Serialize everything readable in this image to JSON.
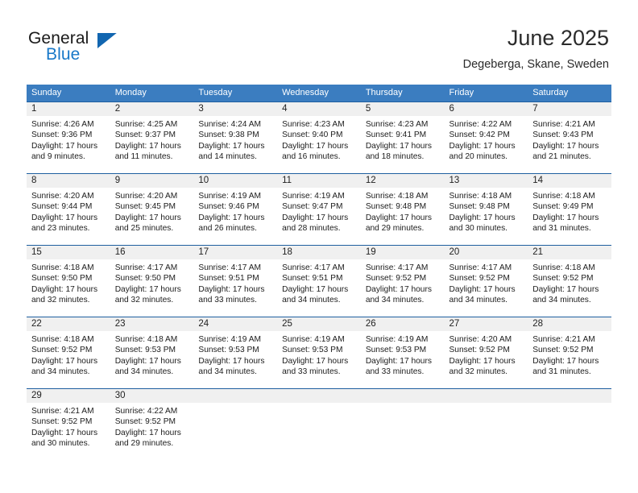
{
  "brand": {
    "name_part1": "General",
    "name_part2": "Blue",
    "accent_color": "#1878c8",
    "logo_icon": "triangle-flag-icon"
  },
  "header": {
    "title": "June 2025",
    "location": "Degeberga, Skane, Sweden"
  },
  "calendar": {
    "header_bg": "#3b7dc0",
    "row_border_color": "#1f5fa0",
    "daynum_band_bg": "#f0f0f0",
    "weekdays": [
      "Sunday",
      "Monday",
      "Tuesday",
      "Wednesday",
      "Thursday",
      "Friday",
      "Saturday"
    ],
    "weeks": [
      [
        {
          "day": "1",
          "sunrise": "Sunrise: 4:26 AM",
          "sunset": "Sunset: 9:36 PM",
          "daylight_line1": "Daylight: 17 hours",
          "daylight_line2": "and 9 minutes."
        },
        {
          "day": "2",
          "sunrise": "Sunrise: 4:25 AM",
          "sunset": "Sunset: 9:37 PM",
          "daylight_line1": "Daylight: 17 hours",
          "daylight_line2": "and 11 minutes."
        },
        {
          "day": "3",
          "sunrise": "Sunrise: 4:24 AM",
          "sunset": "Sunset: 9:38 PM",
          "daylight_line1": "Daylight: 17 hours",
          "daylight_line2": "and 14 minutes."
        },
        {
          "day": "4",
          "sunrise": "Sunrise: 4:23 AM",
          "sunset": "Sunset: 9:40 PM",
          "daylight_line1": "Daylight: 17 hours",
          "daylight_line2": "and 16 minutes."
        },
        {
          "day": "5",
          "sunrise": "Sunrise: 4:23 AM",
          "sunset": "Sunset: 9:41 PM",
          "daylight_line1": "Daylight: 17 hours",
          "daylight_line2": "and 18 minutes."
        },
        {
          "day": "6",
          "sunrise": "Sunrise: 4:22 AM",
          "sunset": "Sunset: 9:42 PM",
          "daylight_line1": "Daylight: 17 hours",
          "daylight_line2": "and 20 minutes."
        },
        {
          "day": "7",
          "sunrise": "Sunrise: 4:21 AM",
          "sunset": "Sunset: 9:43 PM",
          "daylight_line1": "Daylight: 17 hours",
          "daylight_line2": "and 21 minutes."
        }
      ],
      [
        {
          "day": "8",
          "sunrise": "Sunrise: 4:20 AM",
          "sunset": "Sunset: 9:44 PM",
          "daylight_line1": "Daylight: 17 hours",
          "daylight_line2": "and 23 minutes."
        },
        {
          "day": "9",
          "sunrise": "Sunrise: 4:20 AM",
          "sunset": "Sunset: 9:45 PM",
          "daylight_line1": "Daylight: 17 hours",
          "daylight_line2": "and 25 minutes."
        },
        {
          "day": "10",
          "sunrise": "Sunrise: 4:19 AM",
          "sunset": "Sunset: 9:46 PM",
          "daylight_line1": "Daylight: 17 hours",
          "daylight_line2": "and 26 minutes."
        },
        {
          "day": "11",
          "sunrise": "Sunrise: 4:19 AM",
          "sunset": "Sunset: 9:47 PM",
          "daylight_line1": "Daylight: 17 hours",
          "daylight_line2": "and 28 minutes."
        },
        {
          "day": "12",
          "sunrise": "Sunrise: 4:18 AM",
          "sunset": "Sunset: 9:48 PM",
          "daylight_line1": "Daylight: 17 hours",
          "daylight_line2": "and 29 minutes."
        },
        {
          "day": "13",
          "sunrise": "Sunrise: 4:18 AM",
          "sunset": "Sunset: 9:48 PM",
          "daylight_line1": "Daylight: 17 hours",
          "daylight_line2": "and 30 minutes."
        },
        {
          "day": "14",
          "sunrise": "Sunrise: 4:18 AM",
          "sunset": "Sunset: 9:49 PM",
          "daylight_line1": "Daylight: 17 hours",
          "daylight_line2": "and 31 minutes."
        }
      ],
      [
        {
          "day": "15",
          "sunrise": "Sunrise: 4:18 AM",
          "sunset": "Sunset: 9:50 PM",
          "daylight_line1": "Daylight: 17 hours",
          "daylight_line2": "and 32 minutes."
        },
        {
          "day": "16",
          "sunrise": "Sunrise: 4:17 AM",
          "sunset": "Sunset: 9:50 PM",
          "daylight_line1": "Daylight: 17 hours",
          "daylight_line2": "and 32 minutes."
        },
        {
          "day": "17",
          "sunrise": "Sunrise: 4:17 AM",
          "sunset": "Sunset: 9:51 PM",
          "daylight_line1": "Daylight: 17 hours",
          "daylight_line2": "and 33 minutes."
        },
        {
          "day": "18",
          "sunrise": "Sunrise: 4:17 AM",
          "sunset": "Sunset: 9:51 PM",
          "daylight_line1": "Daylight: 17 hours",
          "daylight_line2": "and 34 minutes."
        },
        {
          "day": "19",
          "sunrise": "Sunrise: 4:17 AM",
          "sunset": "Sunset: 9:52 PM",
          "daylight_line1": "Daylight: 17 hours",
          "daylight_line2": "and 34 minutes."
        },
        {
          "day": "20",
          "sunrise": "Sunrise: 4:17 AM",
          "sunset": "Sunset: 9:52 PM",
          "daylight_line1": "Daylight: 17 hours",
          "daylight_line2": "and 34 minutes."
        },
        {
          "day": "21",
          "sunrise": "Sunrise: 4:18 AM",
          "sunset": "Sunset: 9:52 PM",
          "daylight_line1": "Daylight: 17 hours",
          "daylight_line2": "and 34 minutes."
        }
      ],
      [
        {
          "day": "22",
          "sunrise": "Sunrise: 4:18 AM",
          "sunset": "Sunset: 9:52 PM",
          "daylight_line1": "Daylight: 17 hours",
          "daylight_line2": "and 34 minutes."
        },
        {
          "day": "23",
          "sunrise": "Sunrise: 4:18 AM",
          "sunset": "Sunset: 9:53 PM",
          "daylight_line1": "Daylight: 17 hours",
          "daylight_line2": "and 34 minutes."
        },
        {
          "day": "24",
          "sunrise": "Sunrise: 4:19 AM",
          "sunset": "Sunset: 9:53 PM",
          "daylight_line1": "Daylight: 17 hours",
          "daylight_line2": "and 34 minutes."
        },
        {
          "day": "25",
          "sunrise": "Sunrise: 4:19 AM",
          "sunset": "Sunset: 9:53 PM",
          "daylight_line1": "Daylight: 17 hours",
          "daylight_line2": "and 33 minutes."
        },
        {
          "day": "26",
          "sunrise": "Sunrise: 4:19 AM",
          "sunset": "Sunset: 9:53 PM",
          "daylight_line1": "Daylight: 17 hours",
          "daylight_line2": "and 33 minutes."
        },
        {
          "day": "27",
          "sunrise": "Sunrise: 4:20 AM",
          "sunset": "Sunset: 9:52 PM",
          "daylight_line1": "Daylight: 17 hours",
          "daylight_line2": "and 32 minutes."
        },
        {
          "day": "28",
          "sunrise": "Sunrise: 4:21 AM",
          "sunset": "Sunset: 9:52 PM",
          "daylight_line1": "Daylight: 17 hours",
          "daylight_line2": "and 31 minutes."
        }
      ],
      [
        {
          "day": "29",
          "sunrise": "Sunrise: 4:21 AM",
          "sunset": "Sunset: 9:52 PM",
          "daylight_line1": "Daylight: 17 hours",
          "daylight_line2": "and 30 minutes."
        },
        {
          "day": "30",
          "sunrise": "Sunrise: 4:22 AM",
          "sunset": "Sunset: 9:52 PM",
          "daylight_line1": "Daylight: 17 hours",
          "daylight_line2": "and 29 minutes."
        },
        {
          "day": "",
          "sunrise": "",
          "sunset": "",
          "daylight_line1": "",
          "daylight_line2": ""
        },
        {
          "day": "",
          "sunrise": "",
          "sunset": "",
          "daylight_line1": "",
          "daylight_line2": ""
        },
        {
          "day": "",
          "sunrise": "",
          "sunset": "",
          "daylight_line1": "",
          "daylight_line2": ""
        },
        {
          "day": "",
          "sunrise": "",
          "sunset": "",
          "daylight_line1": "",
          "daylight_line2": ""
        },
        {
          "day": "",
          "sunrise": "",
          "sunset": "",
          "daylight_line1": "",
          "daylight_line2": ""
        }
      ]
    ]
  }
}
